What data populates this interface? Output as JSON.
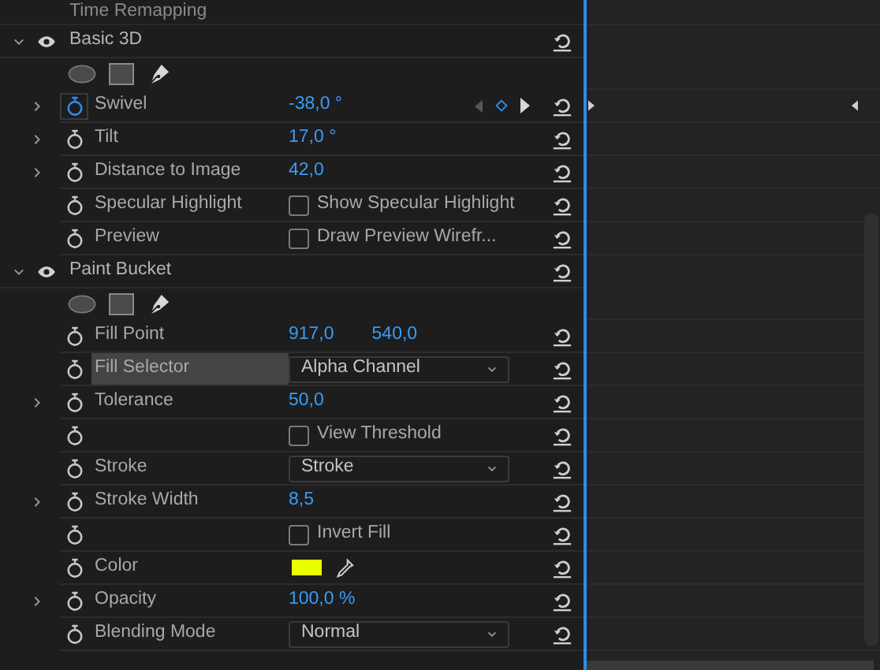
{
  "partial_row": {
    "label": "Time Remapping"
  },
  "effects": [
    {
      "name": "Basic 3D",
      "expanded": true,
      "visible": true,
      "properties": [
        {
          "kind": "value",
          "label": "Swivel",
          "expandable": true,
          "animated": true,
          "highlighted": false,
          "values": [
            "-38,0 °"
          ]
        },
        {
          "kind": "value",
          "label": "Tilt",
          "expandable": true,
          "animated": false,
          "highlighted": false,
          "values": [
            "17,0 °"
          ]
        },
        {
          "kind": "value",
          "label": "Distance to Image",
          "expandable": true,
          "animated": false,
          "highlighted": false,
          "values": [
            "42,0"
          ]
        },
        {
          "kind": "checkbox",
          "label": "Specular Highlight",
          "expandable": false,
          "animated": false,
          "highlighted": false,
          "text": "Show Specular Highlight",
          "checked": false
        },
        {
          "kind": "checkbox",
          "label": "Preview",
          "expandable": false,
          "animated": false,
          "highlighted": false,
          "text": "Draw Preview Wirefr...",
          "checked": false
        }
      ]
    },
    {
      "name": "Paint Bucket",
      "expanded": true,
      "visible": true,
      "properties": [
        {
          "kind": "value",
          "label": "Fill Point",
          "expandable": false,
          "animated": false,
          "highlighted": false,
          "values": [
            "917,0",
            "540,0"
          ]
        },
        {
          "kind": "dropdown",
          "label": "Fill Selector",
          "expandable": false,
          "animated": false,
          "highlighted": true,
          "text": "Alpha Channel"
        },
        {
          "kind": "value",
          "label": "Tolerance",
          "expandable": true,
          "animated": false,
          "highlighted": false,
          "values": [
            "50,0"
          ]
        },
        {
          "kind": "checkbox",
          "expandable": false,
          "animated": false,
          "highlighted": false,
          "text": "View Threshold",
          "checked": false
        },
        {
          "kind": "dropdown",
          "label": "Stroke",
          "expandable": false,
          "animated": false,
          "highlighted": false,
          "text": "Stroke"
        },
        {
          "kind": "value",
          "label": "Stroke Width",
          "expandable": true,
          "animated": false,
          "highlighted": false,
          "values": [
            "8,5"
          ]
        },
        {
          "kind": "checkbox",
          "expandable": false,
          "animated": false,
          "highlighted": false,
          "text": "Invert Fill",
          "checked": false
        },
        {
          "kind": "color",
          "label": "Color",
          "expandable": false,
          "animated": false,
          "highlighted": false,
          "color": "#eaff00"
        },
        {
          "kind": "value",
          "label": "Opacity",
          "expandable": true,
          "animated": false,
          "highlighted": false,
          "values": [
            "100,0 %"
          ]
        },
        {
          "kind": "dropdown",
          "label": "Blending Mode",
          "expandable": false,
          "animated": false,
          "highlighted": false,
          "text": "Normal"
        }
      ]
    }
  ]
}
